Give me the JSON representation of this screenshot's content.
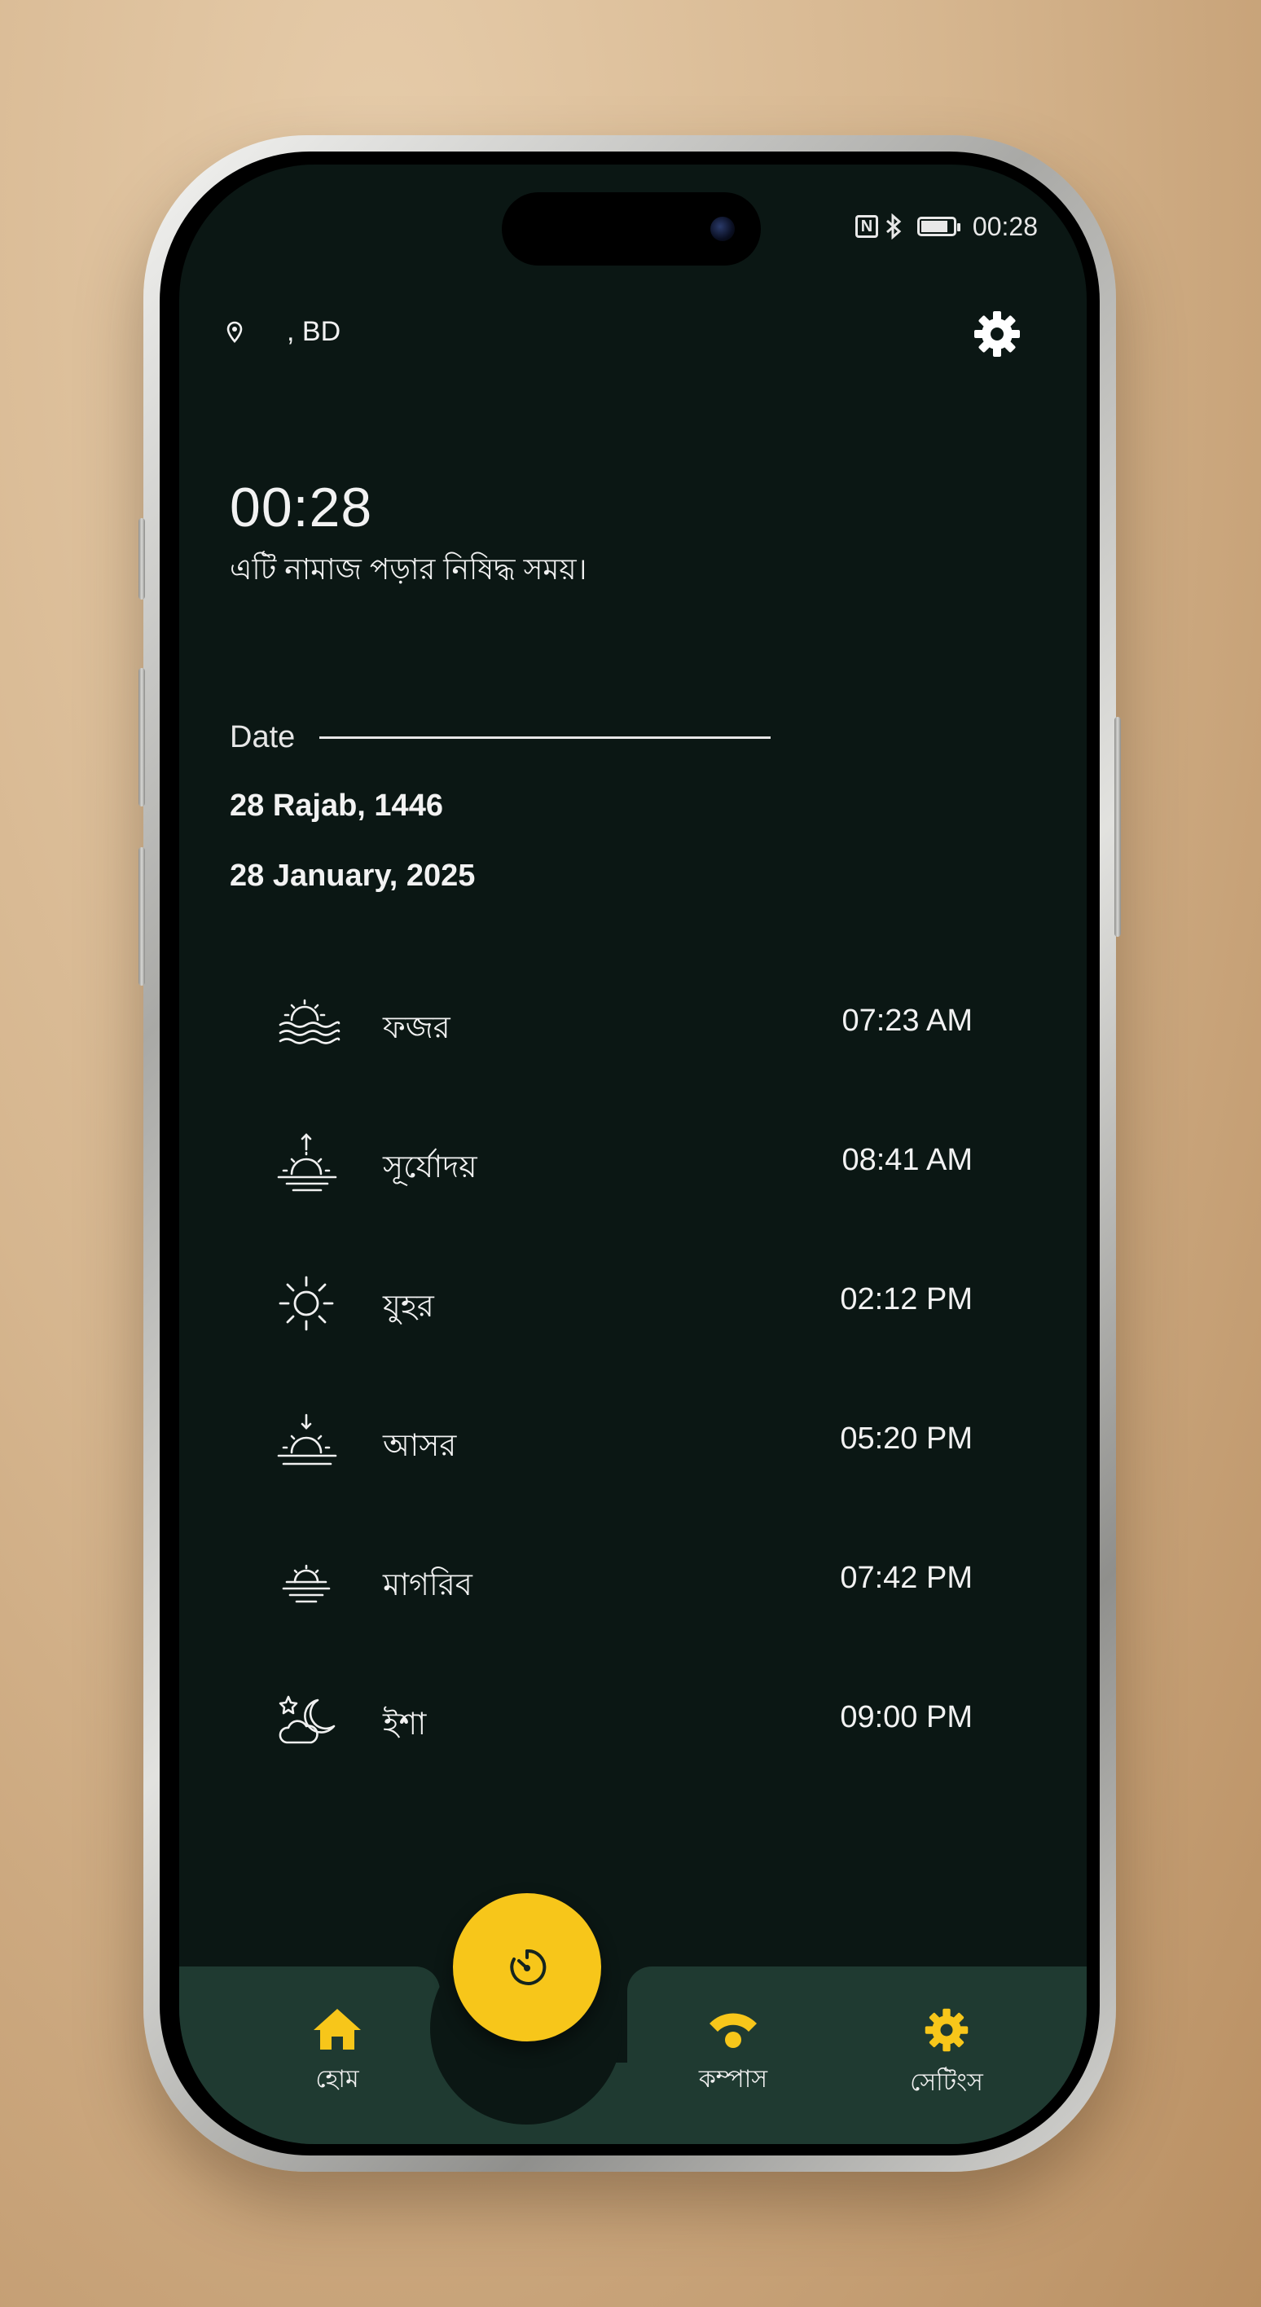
{
  "status_bar": {
    "time": "00:28",
    "nfc_icon": "N",
    "bluetooth_icon": "bluetooth",
    "battery_level": 0.85
  },
  "header": {
    "location": ", BD",
    "location_icon": "map-pin-icon",
    "settings_icon": "gear-icon"
  },
  "clock": {
    "time": "00:28",
    "message": "এটি নামাজ পড়ার নিষিদ্ধ সময়।"
  },
  "date_section": {
    "label": "Date",
    "hijri": "28 Rajab, 1446",
    "gregorian": "28 January, 2025"
  },
  "prayers": [
    {
      "icon": "fajr-icon",
      "name": "ফজর",
      "time": "07:23 AM"
    },
    {
      "icon": "sunrise-icon",
      "name": "সূর্যোদয়",
      "time": "08:41 AM"
    },
    {
      "icon": "sun-icon",
      "name": "যুহর",
      "time": "02:12 PM"
    },
    {
      "icon": "asr-icon",
      "name": "আসর",
      "time": "05:20 PM"
    },
    {
      "icon": "maghrib-icon",
      "name": "মাগরিব",
      "time": "07:42 PM"
    },
    {
      "icon": "isha-icon",
      "name": "ইশা",
      "time": "09:00 PM"
    }
  ],
  "nav": {
    "home_label": "হোম",
    "compass_label": "কম্পাস",
    "settings_label": "সেটিংস",
    "accent": "#f7c61a",
    "bar_color": "#1f3a31"
  }
}
